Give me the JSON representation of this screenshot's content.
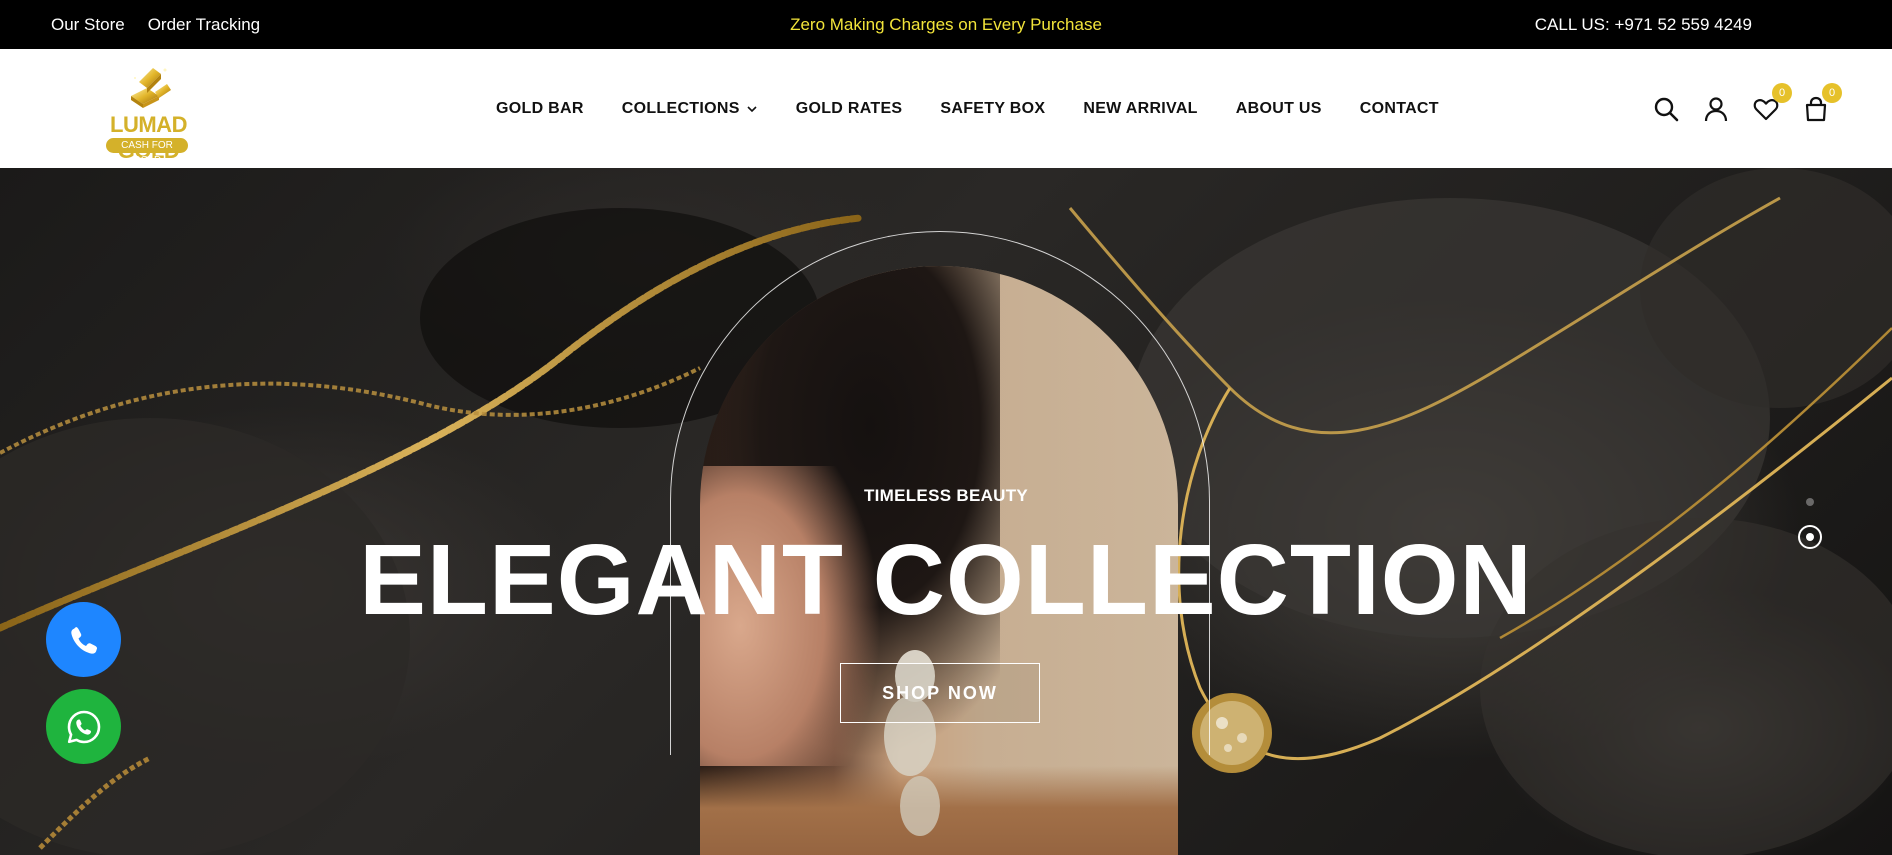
{
  "topbar": {
    "links": [
      "Our Store",
      "Order Tracking"
    ],
    "promo": "Zero Making Charges on Every Purchase",
    "call": "CALL US: +971 52 559 4249"
  },
  "brand": {
    "name": "LUMAD GOLD",
    "tagline": "CASH FOR GOLD",
    "gold_color": "#d4b12a"
  },
  "nav": {
    "items": [
      "GOLD BAR",
      "COLLECTIONS",
      "GOLD RATES",
      "SAFETY BOX",
      "NEW ARRIVAL",
      "ABOUT US",
      "CONTACT"
    ]
  },
  "header_icons": {
    "search": "search-icon",
    "account": "user-icon",
    "wishlist": "heart-icon",
    "wishlist_count": "0",
    "cart": "bag-icon",
    "cart_count": "0",
    "badge_color": "#e6c12a"
  },
  "hero": {
    "eyebrow": "TIMELESS BEAUTY",
    "headline": "ELEGANT COLLECTION",
    "cta": "SHOP NOW",
    "slides_total": 2,
    "active_slide": 2
  },
  "floating": {
    "phone_icon": "phone-icon",
    "whatsapp_icon": "whatsapp-icon",
    "phone_color": "#1e86ff",
    "whatsapp_color": "#1fb43e"
  },
  "colors": {
    "promo_text": "#f2e43a",
    "topbar_bg": "#000000"
  }
}
